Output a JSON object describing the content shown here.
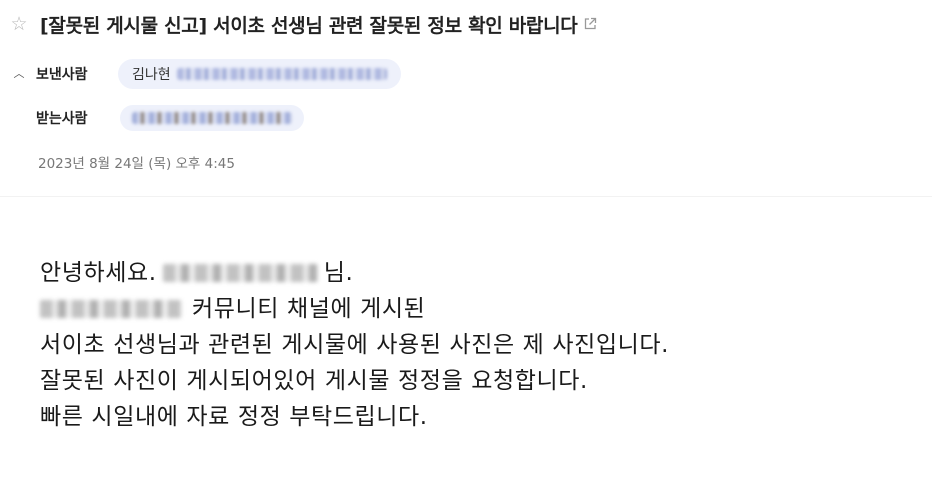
{
  "subject": {
    "star_icon": "star-outline-icon",
    "title": "[잘못된 게시물 신고] 서이초 선생님 관련 잘못된 정보 확인 바랍니다",
    "open_new_window_icon": "external-link-icon"
  },
  "sender": {
    "label": "보낸사람",
    "name": "김나현",
    "collapse_icon": "chevron-up-icon"
  },
  "recipient": {
    "label": "받는사람"
  },
  "date": "2023년 8월 24일 (목) 오후 4:45",
  "body": {
    "line1_before": "안녕하세요. ",
    "line1_after": "님.",
    "line2_after": "커뮤니티 채널에 게시된",
    "line3": "서이초 선생님과 관련된 게시물에 사용된 사진은 제 사진입니다.",
    "line4": "잘못된 사진이 게시되어있어 게시물 정정을 요청합니다.",
    "line5": "빠른 시일내에 자료 정정 부탁드립니다."
  },
  "colors": {
    "chip_background": "#eef1fb",
    "text_primary": "#222222",
    "text_muted": "#777777"
  }
}
